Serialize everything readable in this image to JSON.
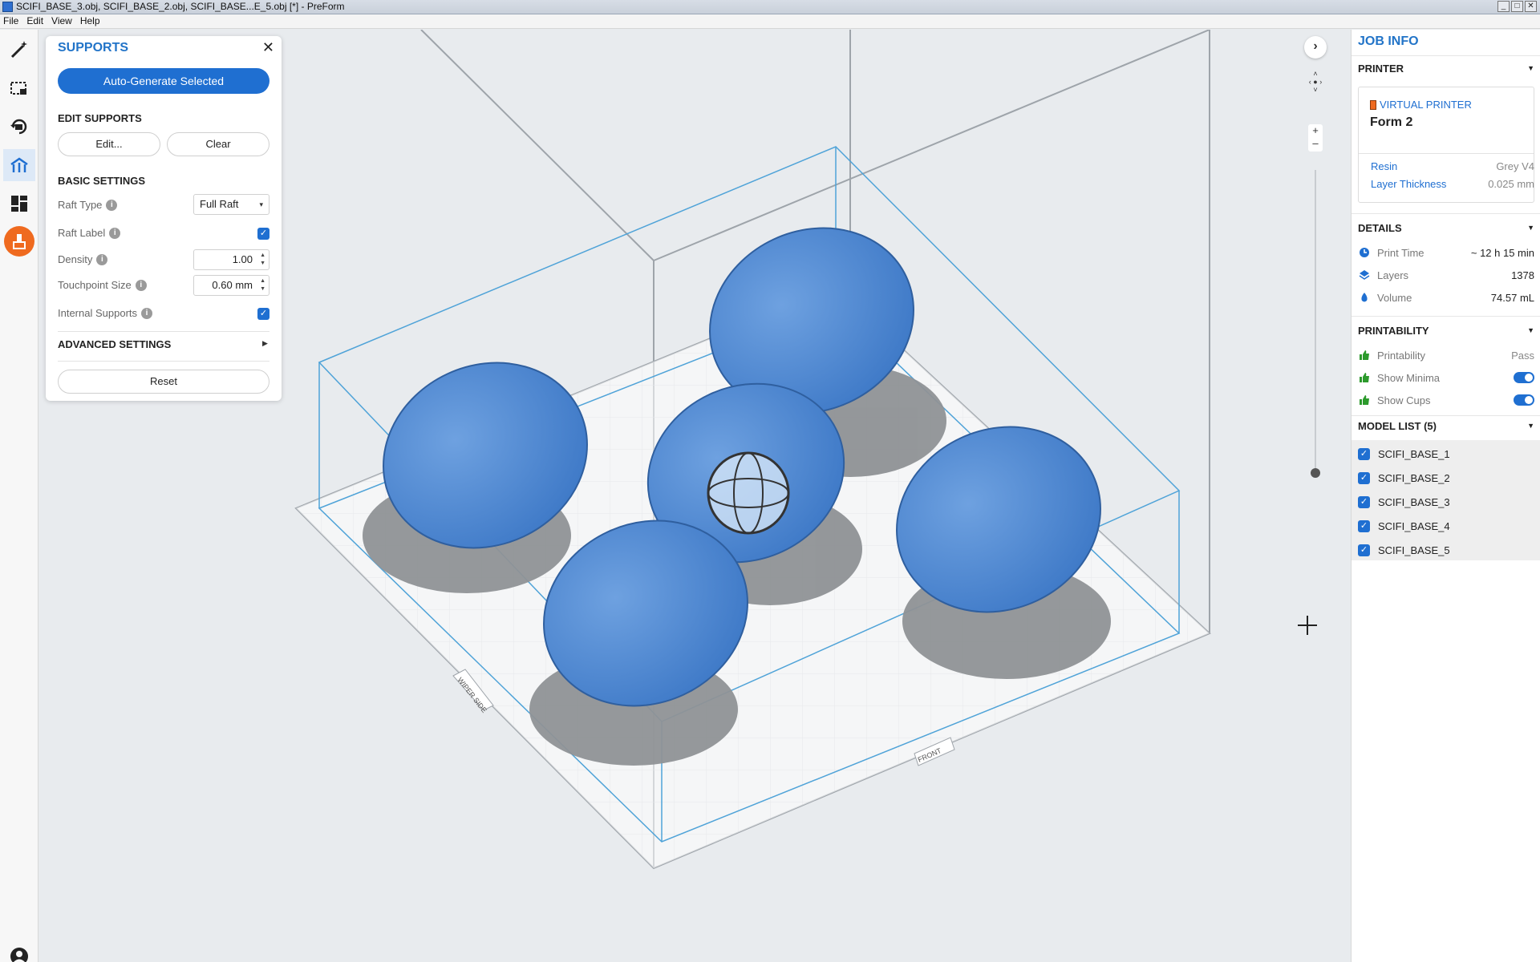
{
  "window": {
    "title": "SCIFI_BASE_3.obj, SCIFI_BASE_2.obj, SCIFI_BASE...E_5.obj [*] - PreForm"
  },
  "menu": [
    "File",
    "Edit",
    "View",
    "Help"
  ],
  "supports": {
    "title": "SUPPORTS",
    "auto_generate": "Auto-Generate Selected",
    "edit_section": "EDIT SUPPORTS",
    "edit_button": "Edit...",
    "clear_button": "Clear",
    "basic_section": "BASIC SETTINGS",
    "raft_type_label": "Raft Type",
    "raft_type_value": "Full Raft",
    "raft_label_label": "Raft Label",
    "raft_label_checked": true,
    "density_label": "Density",
    "density_value": "1.00",
    "touchpoint_label": "Touchpoint Size",
    "touchpoint_value": "0.60 mm",
    "internal_label": "Internal Supports",
    "internal_checked": true,
    "advanced_section": "ADVANCED SETTINGS",
    "reset_button": "Reset"
  },
  "job": {
    "title": "JOB INFO",
    "printer_section": "PRINTER",
    "printer_kind": "VIRTUAL PRINTER",
    "printer_name": "Form 2",
    "resin_label": "Resin",
    "resin_value": "Grey V4",
    "layer_label": "Layer Thickness",
    "layer_value": "0.025 mm",
    "details_section": "DETAILS",
    "print_time_label": "Print Time",
    "print_time_value": "~ 12 h 15 min",
    "layers_label": "Layers",
    "layers_value": "1378",
    "volume_label": "Volume",
    "volume_value": "74.57 mL",
    "printability_section": "PRINTABILITY",
    "printability_label": "Printability",
    "printability_value": "Pass",
    "show_minima_label": "Show Minima",
    "show_cups_label": "Show Cups",
    "model_list_section": "MODEL LIST (5)",
    "models": [
      "SCIFI_BASE_1",
      "SCIFI_BASE_2",
      "SCIFI_BASE_3",
      "SCIFI_BASE_4",
      "SCIFI_BASE_5"
    ]
  },
  "viewport": {
    "wiper_label": "WIPER SIDE",
    "front_label": "FRONT"
  },
  "colors": {
    "accent": "#1f6fd1",
    "model_blue": "#4a86d4",
    "support_gray": "#8f9296",
    "alert_orange": "#ef6a1f",
    "build_outline": "#4fa3d8"
  }
}
